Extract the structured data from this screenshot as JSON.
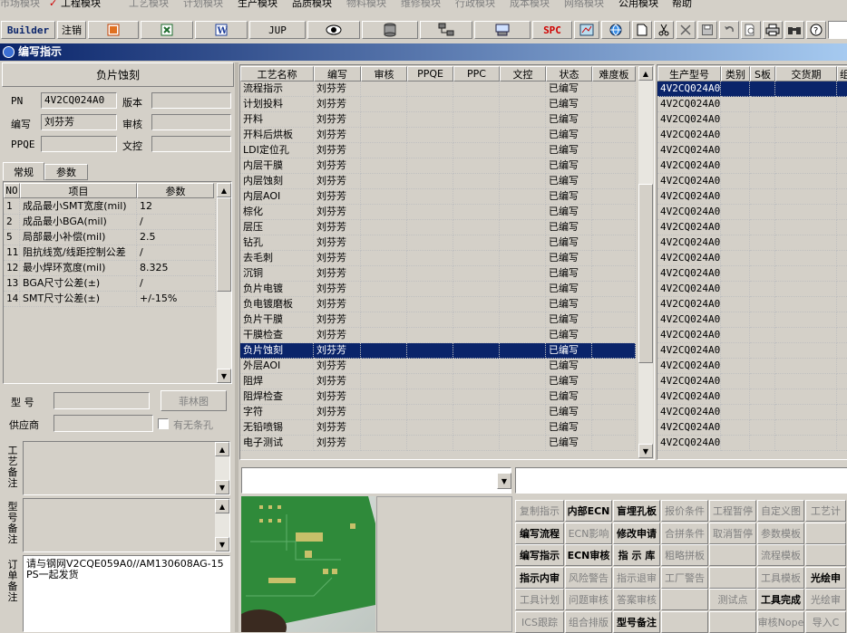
{
  "menubar": {
    "items": [
      {
        "label": "市场模块",
        "enabled": false
      },
      {
        "label": "工程模块",
        "enabled": true,
        "checked": true
      },
      {
        "label": "工艺模块",
        "enabled": false
      },
      {
        "label": "计划模块",
        "enabled": false
      },
      {
        "label": "生产模块",
        "enabled": true
      },
      {
        "label": "品质模块",
        "enabled": true
      },
      {
        "label": "物料模块",
        "enabled": false
      },
      {
        "label": "维修模块",
        "enabled": false
      },
      {
        "label": "行政模块",
        "enabled": false
      },
      {
        "label": "成本模块",
        "enabled": false
      },
      {
        "label": "网络模块",
        "enabled": false
      },
      {
        "label": "公用模块",
        "enabled": true
      },
      {
        "label": "帮助",
        "enabled": true
      }
    ]
  },
  "toolbar": {
    "builder_label": "Builder",
    "logout_label": "注销",
    "jup_label": "JUP",
    "spc_label": "SPC",
    "icons": [
      "ppt-icon",
      "excel-icon",
      "word-icon",
      "eye-icon",
      "database-icon",
      "network-icon",
      "printer-setup-icon",
      "chart-icon",
      "browser-icon",
      "new-file-icon",
      "cut-icon",
      "delete-icon",
      "save-icon",
      "undo-icon",
      "preview-icon",
      "print-icon",
      "find-icon",
      "help-icon"
    ]
  },
  "window": {
    "title": "编写指示"
  },
  "process_panel": {
    "title": "负片蚀刻",
    "pn_label": "PN",
    "pn_value": "4V2CQ024A0",
    "version_label": "版本",
    "version_value": "",
    "author_label": "编写",
    "author_value": "刘芬芳",
    "review_label": "审核",
    "review_value": "",
    "ppqe_label": "PPQE",
    "ppqe_value": "",
    "doc_control_label": "文控",
    "doc_control_value": ""
  },
  "param_tabs": [
    "常规",
    "参数"
  ],
  "param_table": {
    "headers": [
      "NO",
      "项目",
      "参数"
    ],
    "rows": [
      {
        "no": "1",
        "item": "成品最小SMT宽度(mil)",
        "value": "12"
      },
      {
        "no": "2",
        "item": "成品最小BGA(mil)",
        "value": "/"
      },
      {
        "no": "5",
        "item": "局部最小补偿(mil)",
        "value": "2.5"
      },
      {
        "no": "11",
        "item": "阻抗线宽/线距控制公差",
        "value": "/"
      },
      {
        "no": "12",
        "item": "最小焊环宽度(mil)",
        "value": "8.325"
      },
      {
        "no": "13",
        "item": "BGA尺寸公差(±)",
        "value": "/"
      },
      {
        "no": "14",
        "item": "SMT尺寸公差(±)",
        "value": "+/-15%"
      }
    ]
  },
  "lower_left": {
    "model_label": "型  号",
    "model_value": "",
    "forest_button": "菲林图",
    "supplier_label": "供应商",
    "supplier_value": "",
    "no_hole_label": "有无条孔",
    "process_note_label": "工艺备注",
    "model_note_label": "型号备注",
    "order_note_label": "订单备注",
    "order_note_value": "请与钢网V2CQE059A0//AM130608AG-15 PS一起发货"
  },
  "process_grid": {
    "headers": [
      "工艺名称",
      "编写",
      "审核",
      "PPQE",
      "PPC",
      "文控",
      "状态",
      "难度板"
    ],
    "selected_index": 17,
    "rows": [
      {
        "name": "流程指示",
        "author": "刘芬芳",
        "status": "已编写"
      },
      {
        "name": "计划投料",
        "author": "刘芬芳",
        "status": "已编写"
      },
      {
        "name": "开料",
        "author": "刘芬芳",
        "status": "已编写"
      },
      {
        "name": "开料后烘板",
        "author": "刘芬芳",
        "status": "已编写"
      },
      {
        "name": "LDI定位孔",
        "author": "刘芬芳",
        "status": "已编写"
      },
      {
        "name": "内层干膜",
        "author": "刘芬芳",
        "status": "已编写"
      },
      {
        "name": "内层蚀刻",
        "author": "刘芬芳",
        "status": "已编写"
      },
      {
        "name": "内层AOI",
        "author": "刘芬芳",
        "status": "已编写"
      },
      {
        "name": "棕化",
        "author": "刘芬芳",
        "status": "已编写"
      },
      {
        "name": "层压",
        "author": "刘芬芳",
        "status": "已编写"
      },
      {
        "name": "钻孔",
        "author": "刘芬芳",
        "status": "已编写"
      },
      {
        "name": "去毛刺",
        "author": "刘芬芳",
        "status": "已编写"
      },
      {
        "name": "沉铜",
        "author": "刘芬芳",
        "status": "已编写"
      },
      {
        "name": "负片电镀",
        "author": "刘芬芳",
        "status": "已编写"
      },
      {
        "name": "负电镀磨板",
        "author": "刘芬芳",
        "status": "已编写"
      },
      {
        "name": "负片干膜",
        "author": "刘芬芳",
        "status": "已编写"
      },
      {
        "name": "干膜检查",
        "author": "刘芬芳",
        "status": "已编写"
      },
      {
        "name": "负片蚀刻",
        "author": "刘芬芳",
        "status": "已编写"
      },
      {
        "name": "外层AOI",
        "author": "刘芬芳",
        "status": "已编写"
      },
      {
        "name": "阻焊",
        "author": "刘芬芳",
        "status": "已编写"
      },
      {
        "name": "阻焊检查",
        "author": "刘芬芳",
        "status": "已编写"
      },
      {
        "name": "字符",
        "author": "刘芬芳",
        "status": "已编写"
      },
      {
        "name": "无铅喷锡",
        "author": "刘芬芳",
        "status": "已编写"
      },
      {
        "name": "电子测试",
        "author": "刘芬芳",
        "status": "已编写"
      }
    ]
  },
  "model_grid": {
    "headers": [
      "生产型号",
      "类别",
      "S板",
      "交货期",
      "组"
    ],
    "rows": [
      "4V2CQ024A0",
      "4V2CQ024A0",
      "4V2CQ024A0",
      "4V2CQ024A0",
      "4V2CQ024A0",
      "4V2CQ024A0",
      "4V2CQ024A0",
      "4V2CQ024A0",
      "4V2CQ024A0",
      "4V2CQ024A0",
      "4V2CQ024A0",
      "4V2CQ024A0",
      "4V2CQ024A0",
      "4V2CQ024A0",
      "4V2CQ024A0",
      "4V2CQ024A0",
      "4V2CQ024A0",
      "4V2CQ024A0",
      "4V2CQ024A0",
      "4V2CQ024A0",
      "4V2CQ024A0",
      "4V2CQ024A0",
      "4V2CQ024A0",
      "4V2CQ024A0"
    ]
  },
  "actions": [
    {
      "label": "复制指示",
      "enabled": false
    },
    {
      "label": "内部ECN",
      "enabled": true
    },
    {
      "label": "盲埋孔板",
      "enabled": true
    },
    {
      "label": "报价条件",
      "enabled": false
    },
    {
      "label": "工程暂停",
      "enabled": false
    },
    {
      "label": "自定义图",
      "enabled": false
    },
    {
      "label": "工艺计",
      "enabled": false
    },
    {
      "label": "编写流程",
      "enabled": true
    },
    {
      "label": "ECN影响",
      "enabled": false
    },
    {
      "label": "修改申请",
      "enabled": true
    },
    {
      "label": "合拼条件",
      "enabled": false
    },
    {
      "label": "取消暂停",
      "enabled": false
    },
    {
      "label": "参数模板",
      "enabled": false
    },
    {
      "label": "",
      "enabled": false
    },
    {
      "label": "编写指示",
      "enabled": true
    },
    {
      "label": "ECN审核",
      "enabled": true
    },
    {
      "label": "指 示 库",
      "enabled": true
    },
    {
      "label": "粗略拼板",
      "enabled": false
    },
    {
      "label": "",
      "enabled": false
    },
    {
      "label": "流程模板",
      "enabled": false
    },
    {
      "label": "",
      "enabled": false
    },
    {
      "label": "指示内审",
      "enabled": true
    },
    {
      "label": "风险警告",
      "enabled": false
    },
    {
      "label": "指示退审",
      "enabled": false
    },
    {
      "label": "工厂警告",
      "enabled": false
    },
    {
      "label": "",
      "enabled": false
    },
    {
      "label": "工具模板",
      "enabled": false
    },
    {
      "label": "光绘申",
      "enabled": true
    },
    {
      "label": "工具计划",
      "enabled": false
    },
    {
      "label": "问题审核",
      "enabled": false
    },
    {
      "label": "答案审核",
      "enabled": false
    },
    {
      "label": "",
      "enabled": false
    },
    {
      "label": "测试点",
      "enabled": false
    },
    {
      "label": "工具完成",
      "enabled": true
    },
    {
      "label": "光绘审",
      "enabled": false
    },
    {
      "label": "ICS跟踪",
      "enabled": false
    },
    {
      "label": "组合排版",
      "enabled": false
    },
    {
      "label": "型号备注",
      "enabled": true
    },
    {
      "label": "",
      "enabled": false
    },
    {
      "label": "",
      "enabled": false
    },
    {
      "label": "审核Nope",
      "enabled": false
    },
    {
      "label": "导入C",
      "enabled": false
    }
  ],
  "colors": {
    "face": "#d4d0c8",
    "selection": "#0a246a",
    "title_start": "#0a246a",
    "title_end": "#a6caf0",
    "pcb_green": "#2f8a3a"
  }
}
